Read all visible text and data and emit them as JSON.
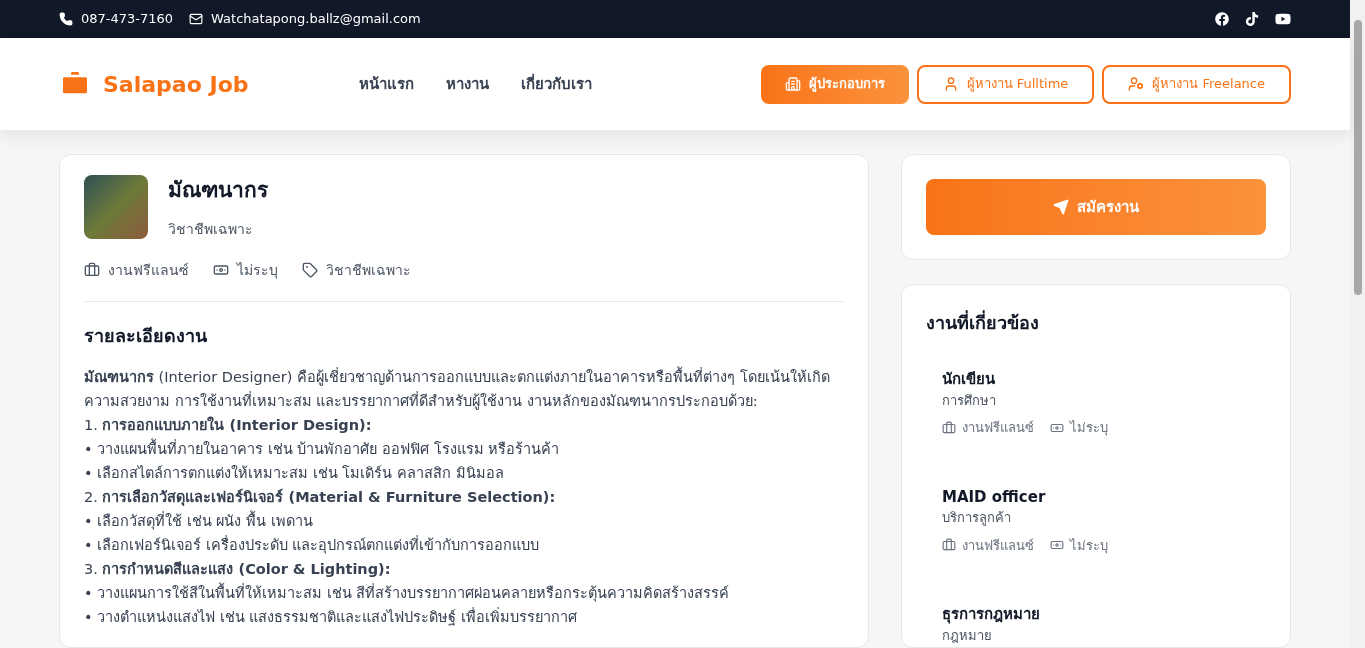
{
  "topbar": {
    "phone": "087-473-7160",
    "email": "Watchatapong.ballz@gmail.com"
  },
  "header": {
    "logo": "Salapao Job",
    "nav": [
      {
        "label": "หน้าแรก"
      },
      {
        "label": "หางาน"
      },
      {
        "label": "เกี่ยวกับเรา"
      }
    ],
    "buttons": [
      {
        "label": "ผู้ประกอบการ",
        "kind": "filled"
      },
      {
        "label": "ผู้หางาน Fulltime",
        "kind": "outline"
      },
      {
        "label": "ผู้หางาน Freelance",
        "kind": "outline"
      }
    ]
  },
  "job": {
    "title": "มัณฑนากร",
    "category": "วิชาชีพเฉพาะ",
    "meta": [
      {
        "kind": "type",
        "text": "งานฟรีแลนซ์"
      },
      {
        "kind": "salary",
        "text": "ไม่ระบุ"
      },
      {
        "kind": "tag",
        "text": "วิชาชีพเฉพาะ"
      }
    ],
    "section_title": "รายละเอียดงาน",
    "description": [
      "**มัณฑนากร** (Interior Designer) คือผู้เชี่ยวชาญด้านการออกแบบและตกแต่งภายในอาคารหรือพื้นที่ต่างๆ โดยเน้นให้เกิดความสวยงาม การใช้งานที่เหมาะสม และบรรยากาศที่ดีสำหรับผู้ใช้งาน งานหลักของมัณฑนากรประกอบด้วย:",
      "1. **การออกแบบภายใน (Interior Design):**",
      "• วางแผนพื้นที่ภายในอาคาร เช่น บ้านพักอาศัย ออฟฟิศ โรงแรม หรือร้านค้า",
      "• เลือกสไตล์การตกแต่งให้เหมาะสม เช่น โมเดิร์น คลาสสิก มินิมอล",
      "2. **การเลือกวัสดุและเฟอร์นิเจอร์ (Material & Furniture Selection):**",
      "• เลือกวัสดุที่ใช้ เช่น ผนัง พื้น เพดาน",
      "• เลือกเฟอร์นิเจอร์ เครื่องประดับ และอุปกรณ์ตกแต่งที่เข้ากับการออกแบบ",
      "3. **การกำหนดสีและแสง (Color & Lighting):**",
      "• วางแผนการใช้สีในพื้นที่ให้เหมาะสม เช่น สีที่สร้างบรรยากาศผ่อนคลายหรือกระตุ้นความคิดสร้างสรรค์",
      "• วางตำแหน่งแสงไฟ เช่น แสงธรรมชาติและแสงไฟประดิษฐ์ เพื่อเพิ่มบรรยากาศ"
    ]
  },
  "apply_button": "สมัครงาน",
  "related": {
    "title": "งานที่เกี่ยวข้อง",
    "jobs": [
      {
        "title": "นักเขียน",
        "category": "การศึกษา",
        "type": "งานฟรีแลนซ์",
        "salary": "ไม่ระบุ"
      },
      {
        "title": "MAID officer",
        "category": "บริการลูกค้า",
        "type": "งานฟรีแลนซ์",
        "salary": "ไม่ระบุ"
      },
      {
        "title": "ธุรการกฎหมาย",
        "category": "กฎหมาย"
      }
    ]
  }
}
